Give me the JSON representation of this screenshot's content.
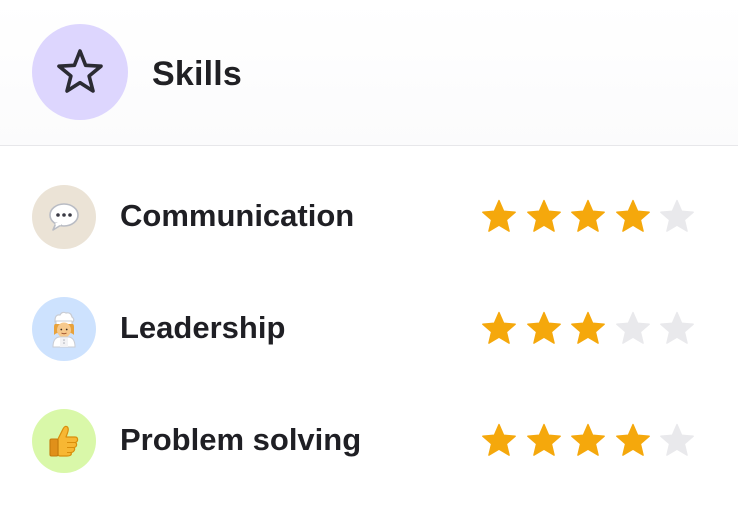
{
  "header": {
    "title": "Skills",
    "icon": "star-outline-icon",
    "icon_bg": "#ddd6fe"
  },
  "rating_max": 5,
  "colors": {
    "star_filled": "#f5a80c",
    "star_empty": "#e9e9ec"
  },
  "skills": [
    {
      "label": "Communication",
      "rating": 4,
      "icon": "speech-bubble-icon",
      "icon_bg": "#ebe3d6"
    },
    {
      "label": "Leadership",
      "rating": 3,
      "icon": "chef-person-icon",
      "icon_bg": "#cde2fe"
    },
    {
      "label": "Problem solving",
      "rating": 4,
      "icon": "thumbs-up-icon",
      "icon_bg": "#d9f8a9"
    }
  ]
}
